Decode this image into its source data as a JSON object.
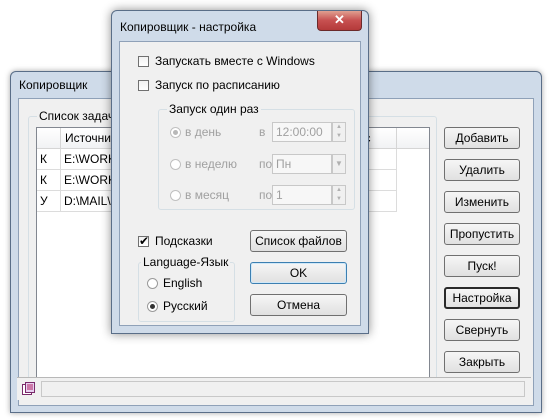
{
  "main_window": {
    "title": "Копировщик",
    "task_group_label": "Список задач",
    "columns": [
      "Источни",
      "тус"
    ],
    "rows": [
      {
        "type": "К",
        "source": "E:\\WORK\\"
      },
      {
        "type": "К",
        "source": "E:\\WORK\\"
      },
      {
        "type": "У",
        "source": "D:\\MAIL\\c"
      }
    ],
    "buttons": {
      "add": "Добавить",
      "delete": "Удалить",
      "edit": "Изменить",
      "skip": "Пропустить",
      "start": "Пуск!",
      "settings": "Настройка",
      "minimize": "Свернуть",
      "close": "Закрыть"
    }
  },
  "dialog": {
    "title": "Копировщик - настройка",
    "autostart": {
      "label": "Запускать вместе с Windows",
      "checked": false
    },
    "schedule": {
      "label": "Запуск по расписанию",
      "checked": false
    },
    "run_once": {
      "label": "Запуск один раз",
      "daily": {
        "label": "в день",
        "prep": "в",
        "value": "12:00:00",
        "selected": true
      },
      "weekly": {
        "label": "в неделю",
        "prep": "по",
        "value": "Пн"
      },
      "monthly": {
        "label": "в месяц",
        "prep": "по",
        "value": "1"
      }
    },
    "hints": {
      "label": "Подсказки",
      "checked": true
    },
    "language": {
      "label": "Language-Язык",
      "options": [
        {
          "label": "English",
          "selected": false
        },
        {
          "label": "Русский",
          "selected": true
        }
      ]
    },
    "buttons": {
      "file_list": "Список файлов",
      "ok": "OK",
      "cancel": "Отмена"
    }
  },
  "icons": {
    "close": "close-icon",
    "dropdown": "chevron-down-icon",
    "spin": "spin-arrows-icon",
    "status": "app-status-icon"
  },
  "colors": {
    "title_bar": "#cfdbe9",
    "close_button": "#c75050",
    "client": "#f0f0f0"
  }
}
